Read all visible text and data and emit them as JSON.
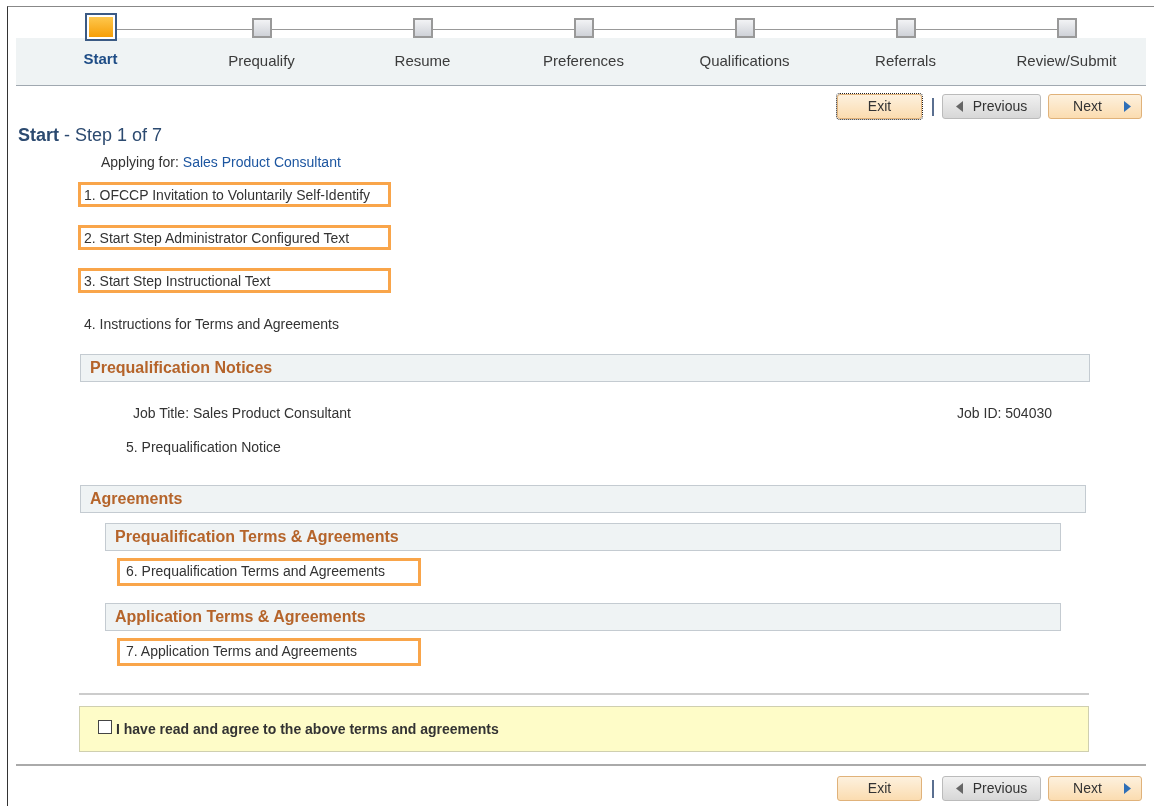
{
  "steps": [
    {
      "label": "Start",
      "selected": true
    },
    {
      "label": "Prequalify",
      "selected": false
    },
    {
      "label": "Resume",
      "selected": false
    },
    {
      "label": "Preferences",
      "selected": false
    },
    {
      "label": "Qualifications",
      "selected": false
    },
    {
      "label": "Referrals",
      "selected": false
    },
    {
      "label": "Review/Submit",
      "selected": false
    }
  ],
  "nav_top": [
    {
      "kind": "exit",
      "label": "Exit",
      "focused": true
    },
    {
      "kind": "previous",
      "label": "Previous",
      "focused": false
    },
    {
      "kind": "next",
      "label": "Next",
      "focused": false
    }
  ],
  "heading": "**Start** - Step 1 of 7",
  "applying_for": {
    "label": "Applying for:",
    "value": "Sales Product Consultant"
  },
  "instructions": [
    {
      "text": "1. OFCCP Invitation to Voluntarily Self-Identify",
      "highlighted": true
    },
    {
      "text": "2. Start Step Administrator Configured Text",
      "highlighted": true
    },
    {
      "text": "3. Start Step Instructional Text",
      "highlighted": true
    },
    {
      "text": "4. Instructions for Terms and Agreements",
      "highlighted": false
    }
  ],
  "prequalification_notices": {
    "title": "Prequalification Notices",
    "job_title": "Job Title: Sales Product Consultant",
    "job_id": "Job ID: 504030",
    "notice": {
      "text": "5. Prequalification Notice",
      "highlighted": false
    }
  },
  "agreements": {
    "title": "Agreements",
    "sections": [
      {
        "title": "Prequalification Terms & Agreements",
        "item": {
          "text": "6. Prequalification Terms and Agreements",
          "highlighted": true
        }
      },
      {
        "title": "Application Terms & Agreements",
        "item": {
          "text": "7. Application Terms and Agreements",
          "highlighted": true
        }
      }
    ]
  },
  "agreement_checkbox": {
    "label": "I have read and agree to the above terms and agreements",
    "checked": false
  },
  "nav_bottom": [
    {
      "kind": "exit",
      "label": "Exit",
      "focused": false
    },
    {
      "kind": "previous",
      "label": "Previous",
      "focused": false
    },
    {
      "kind": "next",
      "label": "Next",
      "focused": false
    }
  ]
}
